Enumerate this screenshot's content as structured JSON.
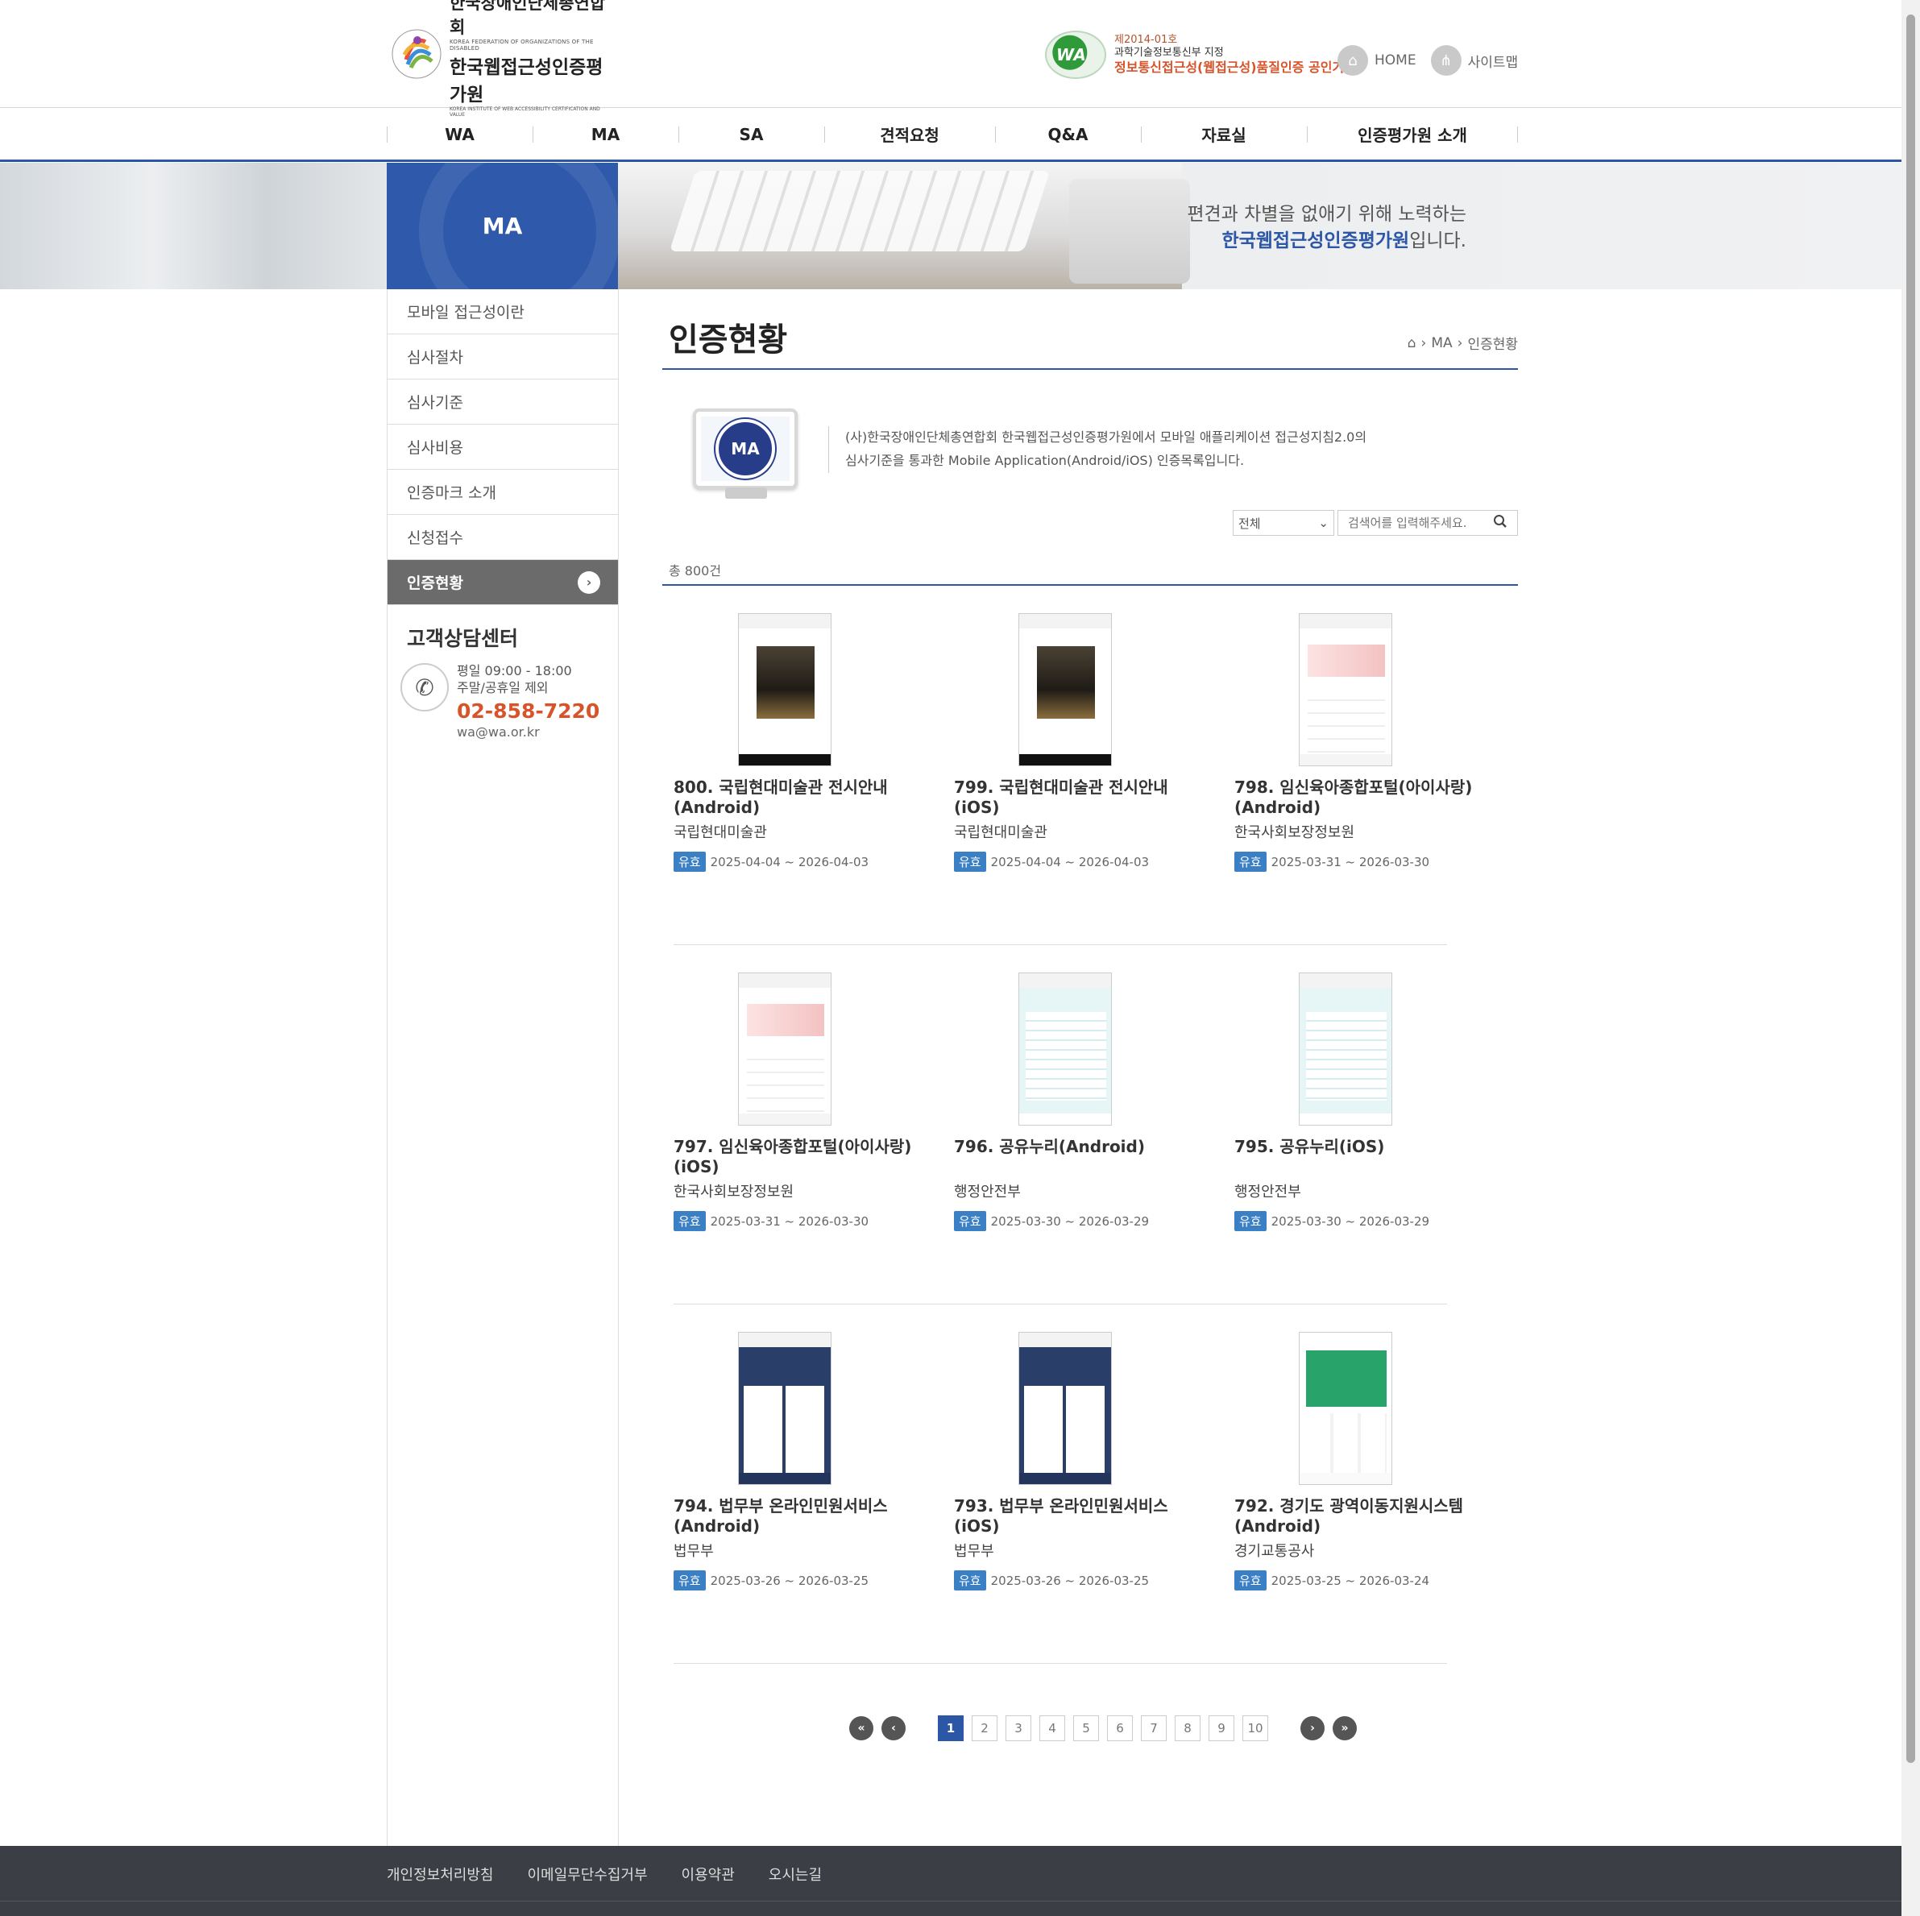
{
  "header": {
    "logo_line1": "한국장애인단체총연합회",
    "logo_sub1": "KOREA FEDERATION OF ORGANIZATIONS OF THE DISABLED",
    "logo_line2": "한국웹접근성인증평가원",
    "logo_sub2": "KOREA INSTITUTE OF WEB ACCESSIBILITY CERTIFICATION AND VALUE",
    "cert_badge": "WA",
    "cert_t1": "제2014-01호",
    "cert_t2": "과학기술정보통신부 지정",
    "cert_t3": "정보통신접근성(웹접근성)품질인증 공인기관",
    "home_label": "HOME",
    "sitemap_label": "사이트맵"
  },
  "gnb": {
    "items": [
      "WA",
      "MA",
      "SA",
      "견적요청",
      "Q&A",
      "자료실",
      "인증평가원 소개"
    ]
  },
  "banner": {
    "section_label": "MA",
    "copy_line1": "편견과 차별을 없애기 위해 노력하는",
    "copy_line2_strong": "한국웹접근성인증평가원",
    "copy_line2_tail": "입니다."
  },
  "lnb": {
    "items": [
      "모바일 접근성이란",
      "심사절차",
      "심사기준",
      "심사비용",
      "인증마크 소개",
      "신청접수",
      "인증현황"
    ],
    "active_index": 6
  },
  "customer_center": {
    "title": "고객상담센터",
    "hours": "평일 09:00 - 18:00",
    "closed": "주말/공휴일 제외",
    "tel": "02-858-7220",
    "email": "wa@wa.or.kr"
  },
  "page": {
    "title": "인증현황",
    "breadcrumb": [
      "MA",
      "인증현황"
    ],
    "intro_badge": "MA",
    "intro_line1": "(사)한국장애인단체총연합회 한국웹접근성인증평가원에서 모바일 애플리케이션 접근성지침2.0의",
    "intro_line2": "심사기준을 통과한 Mobile Application(Android/iOS) 인증목록입니다.",
    "search_select": "전체",
    "search_placeholder": "검색어를 입력해주세요.",
    "total": "총 800건"
  },
  "certifications": [
    {
      "title": "800. 국립현대미술관 전시안내(Android)",
      "org": "국립현대미술관",
      "status": "유효",
      "period": "2025-04-04 ~ 2026-04-03",
      "thumb": "museum"
    },
    {
      "title": "799. 국립현대미술관 전시안내(iOS)",
      "org": "국립현대미술관",
      "status": "유효",
      "period": "2025-04-04 ~ 2026-04-03",
      "thumb": "museum"
    },
    {
      "title": "798. 임신육아종합포털(아이사랑)(Android)",
      "org": "한국사회보장정보원",
      "status": "유효",
      "period": "2025-03-31 ~ 2026-03-30",
      "thumb": "pink"
    },
    {
      "title": "797. 임신육아종합포털(아이사랑)(iOS)",
      "org": "한국사회보장정보원",
      "status": "유효",
      "period": "2025-03-31 ~ 2026-03-30",
      "thumb": "pink"
    },
    {
      "title": "796. 공유누리(Android)",
      "org": "행정안전부",
      "status": "유효",
      "period": "2025-03-30 ~ 2026-03-29",
      "thumb": "mint"
    },
    {
      "title": "795. 공유누리(iOS)",
      "org": "행정안전부",
      "status": "유효",
      "period": "2025-03-30 ~ 2026-03-29",
      "thumb": "mint"
    },
    {
      "title": "794. 법무부 온라인민원서비스(Android)",
      "org": "법무부",
      "status": "유효",
      "period": "2025-03-26 ~ 2026-03-25",
      "thumb": "navy"
    },
    {
      "title": "793. 법무부 온라인민원서비스(iOS)",
      "org": "법무부",
      "status": "유효",
      "period": "2025-03-26 ~ 2026-03-25",
      "thumb": "navy"
    },
    {
      "title": "792. 경기도 광역이동지원시스템(Android)",
      "org": "경기교통공사",
      "status": "유효",
      "period": "2025-03-25 ~ 2026-03-24",
      "thumb": "green"
    }
  ],
  "pagination": {
    "pages": [
      "1",
      "2",
      "3",
      "4",
      "5",
      "6",
      "7",
      "8",
      "9",
      "10"
    ],
    "current": "1",
    "first": "«",
    "prev": "‹",
    "next": "›",
    "last": "»"
  },
  "footer": {
    "links": [
      "개인정보처리방침",
      "이메일무단수집거부",
      "이용약관",
      "오시는길"
    ]
  },
  "colors": {
    "brand_blue": "#2c56a6",
    "tel_orange": "#d9532a",
    "badge_blue": "#3b7fc4",
    "footer_bg": "#3b3e44"
  }
}
